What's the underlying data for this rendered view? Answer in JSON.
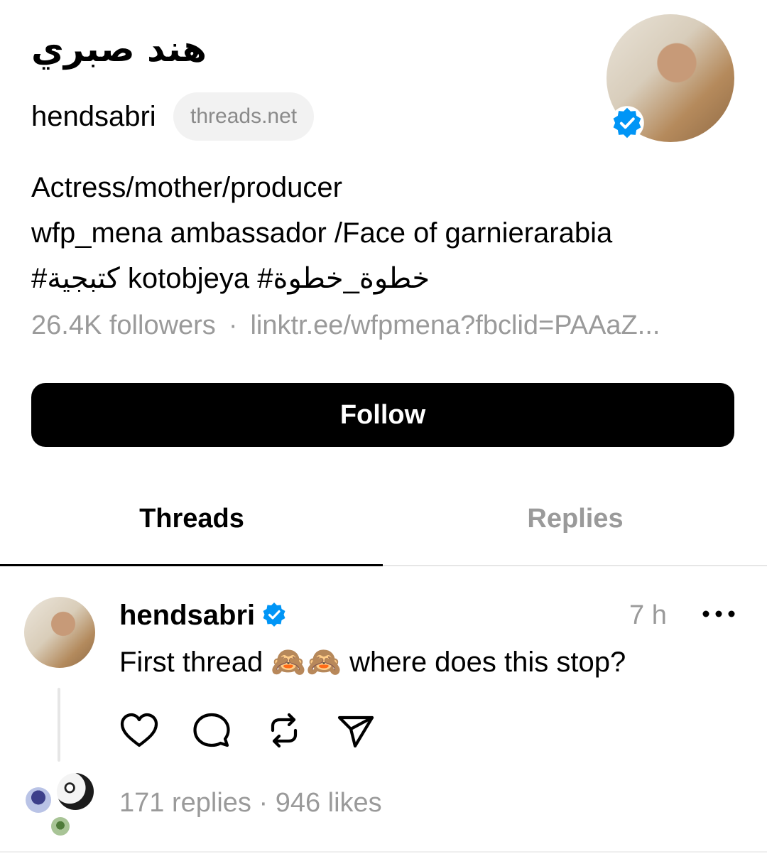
{
  "profile": {
    "display_name": "هند صبري",
    "handle": "hendsabri",
    "domain_pill": "threads.net",
    "bio_lines": [
      "Actress/mother/producer",
      "wfp_mena ambassador /Face of garnierarabia",
      "#كتبجية kotobjeya #خطوة_خطوة"
    ],
    "followers": "26.4K followers",
    "separator": "·",
    "link": "linktr.ee/wfpmena?fbclid=PAAaZ..."
  },
  "follow_button": {
    "label": "Follow"
  },
  "tabs": [
    {
      "label": "Threads",
      "active": true
    },
    {
      "label": "Replies",
      "active": false
    }
  ],
  "post": {
    "author": "hendsabri",
    "time": "7 h",
    "text": "First thread 🙈🙈 where does this stop?",
    "replies": "171 replies",
    "separator": "·",
    "likes": "946 likes"
  },
  "colors": {
    "verified": "#0095f6",
    "muted_text": "#9a9a9a",
    "pill_bg": "#f2f2f2",
    "button_bg": "#000000"
  },
  "icons": [
    "verified-badge-icon",
    "more-icon",
    "heart-icon",
    "comment-icon",
    "repost-icon",
    "share-icon"
  ]
}
